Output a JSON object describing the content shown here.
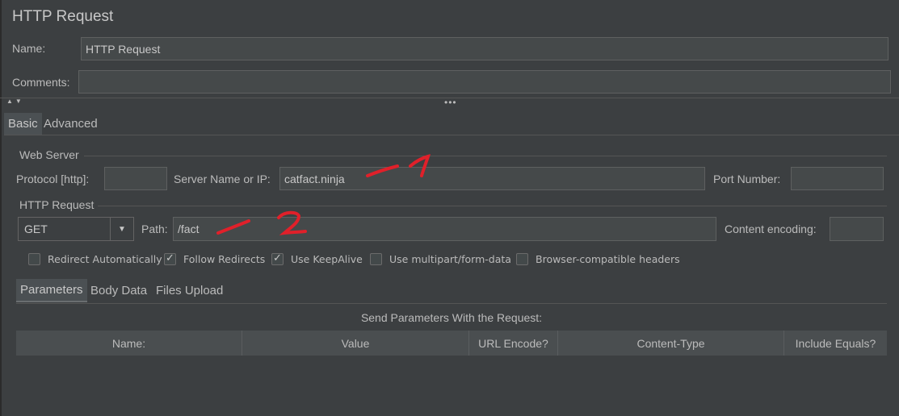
{
  "window": {
    "title": "HTTP Request"
  },
  "name": {
    "label": "Name:",
    "value": "HTTP Request"
  },
  "comments": {
    "label": "Comments:",
    "value": ""
  },
  "top_tabs": [
    {
      "label": "Basic",
      "selected": true
    },
    {
      "label": "Advanced",
      "selected": false
    }
  ],
  "web_server": {
    "title": "Web Server",
    "protocol_label": "Protocol [http]:",
    "protocol_value": "",
    "server_label": "Server Name or IP:",
    "server_value": "catfact.ninja",
    "port_label": "Port Number:",
    "port_value": ""
  },
  "http_request": {
    "title": "HTTP Request",
    "method": "GET",
    "path_label": "Path:",
    "path_value": "/fact",
    "encoding_label": "Content encoding:",
    "encoding_value": ""
  },
  "checkboxes": [
    {
      "label": "Redirect Automatically",
      "checked": false
    },
    {
      "label": "Follow Redirects",
      "checked": true
    },
    {
      "label": "Use KeepAlive",
      "checked": true
    },
    {
      "label": "Use multipart/form-data",
      "checked": false
    },
    {
      "label": "Browser-compatible headers",
      "checked": false
    }
  ],
  "param_tabs": [
    {
      "label": "Parameters",
      "selected": true
    },
    {
      "label": "Body Data",
      "selected": false
    },
    {
      "label": "Files Upload",
      "selected": false
    }
  ],
  "params_caption": "Send Parameters With the Request:",
  "table_columns": [
    "Name:",
    "Value",
    "URL Encode?",
    "Content-Type",
    "Include Equals?"
  ],
  "annotations": [
    "1",
    "2"
  ],
  "colors": {
    "background": "#3c3f41",
    "field": "#45494a",
    "annotation": "#e0202a"
  }
}
